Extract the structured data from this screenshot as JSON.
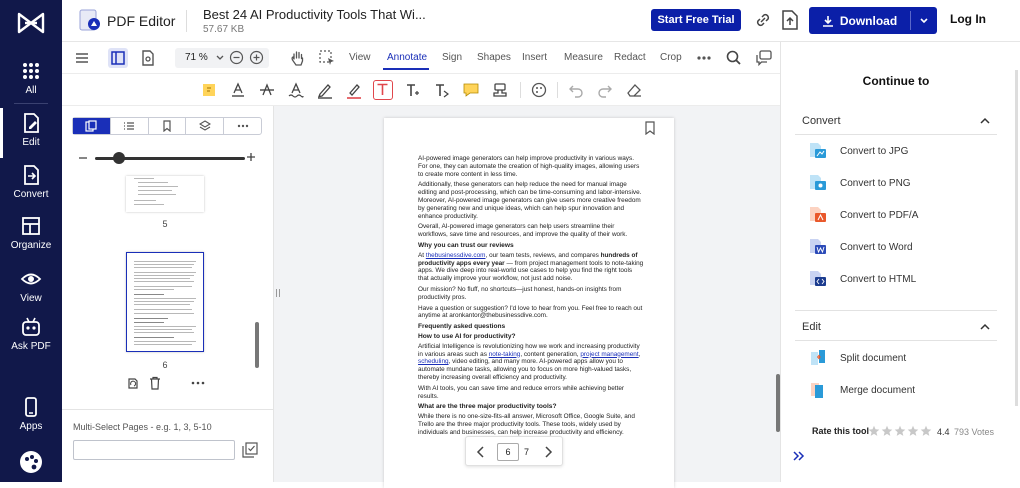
{
  "nav": {
    "items": [
      {
        "label": "All",
        "icon": "grid-icon"
      },
      {
        "label": "Edit",
        "icon": "edit-icon"
      },
      {
        "label": "Convert",
        "icon": "convert-icon"
      },
      {
        "label": "Organize",
        "icon": "organize-icon"
      },
      {
        "label": "View",
        "icon": "eye-icon"
      },
      {
        "label": "Ask PDF",
        "icon": "robot-icon"
      },
      {
        "label": "Apps",
        "icon": "phone-icon"
      }
    ]
  },
  "header": {
    "app_title": "PDF Editor",
    "doc_name": "Best 24 AI Productivity Tools That Wi...",
    "doc_size": "57.67 KB",
    "trial_label": "Start Free Trial",
    "download_label": "Download",
    "login_label": "Log In"
  },
  "toolbar": {
    "zoom": "71 %",
    "tabs": [
      "View",
      "Annotate",
      "Sign",
      "Shapes",
      "Insert",
      "Measure",
      "Redact",
      "Crop"
    ],
    "active_tab": "Annotate"
  },
  "thumbs": {
    "page_labels": [
      "5",
      "6"
    ],
    "multi_select_label": "Multi-Select Pages - e.g. 1, 3, 5-10",
    "multi_select_value": ""
  },
  "document": {
    "paragraphs": [
      "AI-powered image generators can help improve productivity in various ways. For one, they can automate the creation of high-quality images, allowing users to create more content in less time.",
      "Additionally, these generators can help reduce the need for manual image editing and post-processing, which can be time-consuming and labor-intensive. Moreover, AI-powered image generators can give users more creative freedom by generating new and unique ideas, which can help spur innovation and enhance productivity.",
      "Overall, AI-powered image generators can help users streamline their workflows, save time and resources, and improve the quality of their work."
    ],
    "heading_trust": "Why you can trust our reviews",
    "trust_at": "At ",
    "trust_link": "thebusinessdive.com",
    "trust_mid": ", our team tests, reviews, and compares ",
    "trust_bold": "hundreds of productivity apps every year",
    "trust_end": " — from project management tools to note-taking apps. We dive deep into real-world use cases to help you find the right tools that actually improve your workflow, not just add noise.",
    "mission": "Our mission? No fluff, no shortcuts—just honest, hands-on insights from productivity pros.",
    "contact": "Have a question or suggestion? I'd love to hear from you. Feel free to reach out anytime at aronkantor@thebusinessdive.com.",
    "heading_faq": "Frequently asked questions",
    "heading_q1": "How to use AI for productivity?",
    "q1_a": "Artificial Intelligence is revolutionizing how we work and increasing productivity in various areas such as ",
    "q1_link1": "note-taking",
    "q1_b": ", content generation, ",
    "q1_link2": "project management",
    "q1_c": ", ",
    "q1_link3": "scheduling",
    "q1_d": ", video editing, and many more. AI-powered apps allow you to automate mundane tasks, allowing you to focus on more high-valued tasks, thereby increasing overall efficiency and productivity.",
    "q1_p2": "With AI tools, you can save time and reduce errors while achieving better results.",
    "heading_q2": "What are the three major productivity tools?",
    "q2_a": "While there is no one-size-fits-all answer, Microsoft Office, Google Suite, and Trello are the three major productivity tools. These tools, widely used by individuals and businesses, can help increase productivity and efficiency."
  },
  "pager": {
    "current": "6",
    "total": "7"
  },
  "right_panel": {
    "title": "Continue to",
    "convert_label": "Convert",
    "convert_items": [
      "Convert to JPG",
      "Convert to PNG",
      "Convert to PDF/A",
      "Convert to Word",
      "Convert to HTML"
    ],
    "edit_label": "Edit",
    "edit_items": [
      "Split document",
      "Merge document"
    ],
    "rate_label": "Rate this tool",
    "score": "4.4",
    "votes": "793 Votes",
    "rating": 4.4
  },
  "colors": {
    "nav_bg": "#11184a",
    "accent": "#0b1fa8",
    "link": "#1a2fb8"
  }
}
